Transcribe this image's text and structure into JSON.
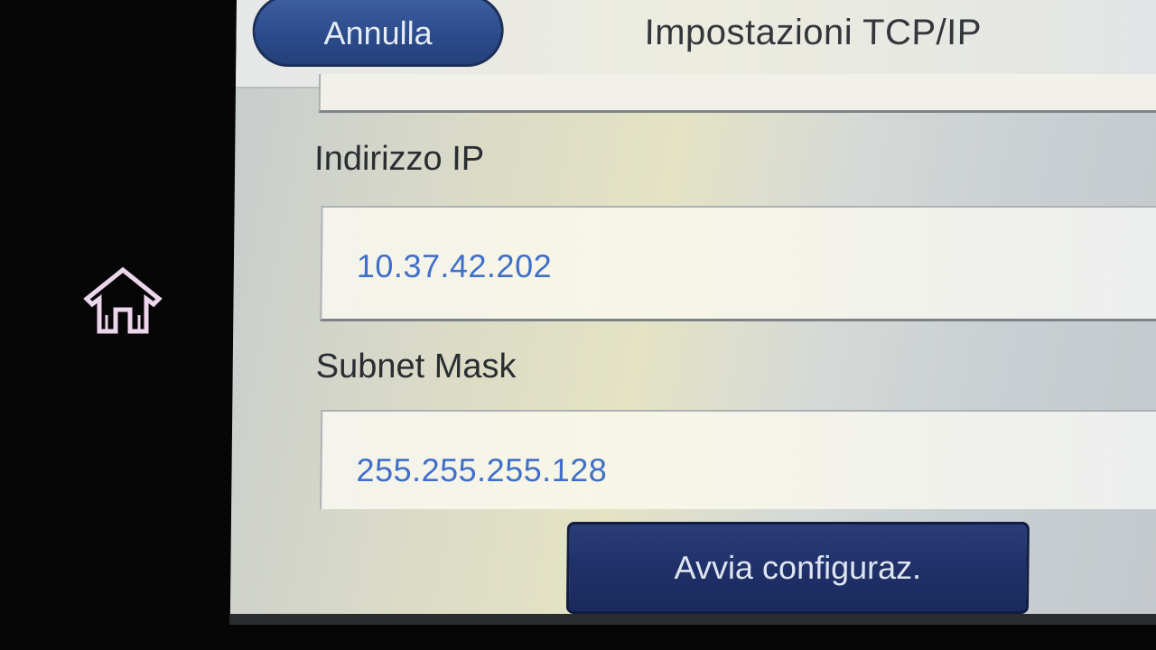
{
  "header": {
    "cancel_label": "Annulla",
    "title": "Impostazioni TCP/IP"
  },
  "fields": [
    {
      "label": "Indirizzo IP",
      "value": "10.37.42.202"
    },
    {
      "label": "Subnet Mask",
      "value": "255.255.255.128"
    }
  ],
  "footer": {
    "start_label": "Avvia configuraz."
  },
  "icons": {
    "home": "home-icon"
  },
  "colors": {
    "button_blue": "#2b4a8a",
    "start_button_navy": "#1f3068",
    "value_text_blue": "#3f6fc9"
  }
}
